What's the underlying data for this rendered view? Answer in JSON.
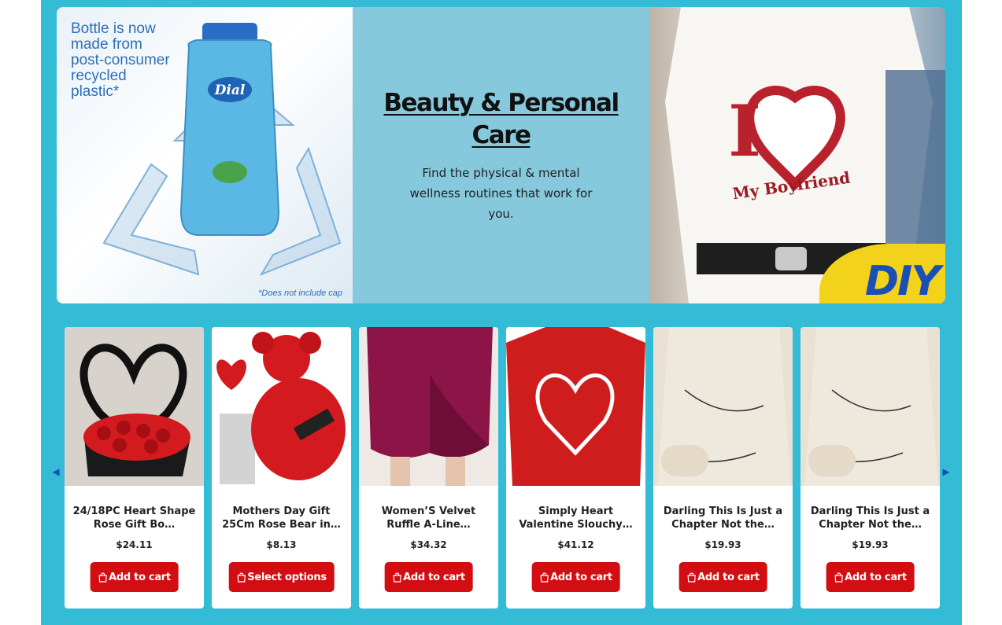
{
  "hero": {
    "left_image": {
      "text": "Bottle is now\nmade from\npost-consumer\nrecycled\nplastic*",
      "note": "*Does not include cap",
      "brand": "Dial"
    },
    "title": "Beauty & Personal Care",
    "description": "Find the physical & mental wellness routines that work for you.",
    "right_image": {
      "shirt_text": "My Boyfriend",
      "badge": "DIY"
    }
  },
  "carousel": {
    "prev_icon": "chevron-left-icon",
    "next_icon": "chevron-right-icon",
    "products": [
      {
        "title": "24/18PC Heart Shape Rose Gift Bo…",
        "price": "$24.11",
        "button": "Add to cart"
      },
      {
        "title": "Mothers Day Gift 25Cm Rose Bear in…",
        "price": "$8.13",
        "button": "Select options"
      },
      {
        "title": "Women’S Velvet Ruffle A-Line…",
        "price": "$34.32",
        "button": "Add to cart"
      },
      {
        "title": "Simply Heart Valentine Slouchy…",
        "price": "$41.12",
        "button": "Add to cart"
      },
      {
        "title": "Darling This Is Just a Chapter Not the…",
        "price": "$19.93",
        "button": "Add to cart"
      },
      {
        "title": "Darling This Is Just a Chapter Not the…",
        "price": "$19.93",
        "button": "Add to cart"
      }
    ]
  },
  "colors": {
    "frame": "#34bcd6",
    "hero_middle": "#86c9dd",
    "button": "#d20e12"
  }
}
